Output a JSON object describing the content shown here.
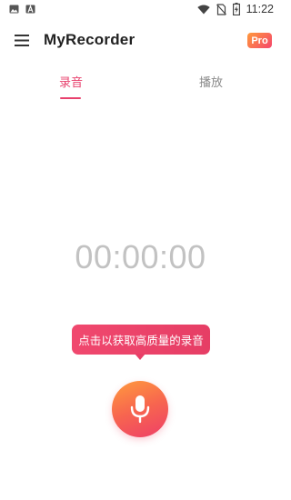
{
  "status_bar": {
    "time": "11:22",
    "left_icons": [
      "gallery-icon",
      "font-a-icon"
    ],
    "right_icons": [
      "wifi-icon",
      "no-sim-icon",
      "battery-charging-icon"
    ]
  },
  "app_bar": {
    "title": "MyRecorder",
    "menu_icon": "hamburger-menu-icon",
    "pro_label": "Pro"
  },
  "tabs": [
    {
      "label": "录音",
      "active": true
    },
    {
      "label": "播放",
      "active": false
    }
  ],
  "recorder": {
    "timer": "00:00:00",
    "tooltip": "点击以获取高质量的录音",
    "button_icon": "microphone-icon"
  },
  "colors": {
    "accent": "#e8416d",
    "timer_text": "#c2c2c2",
    "gradient_start": "#ff9b3d",
    "gradient_end": "#ee3f68"
  }
}
